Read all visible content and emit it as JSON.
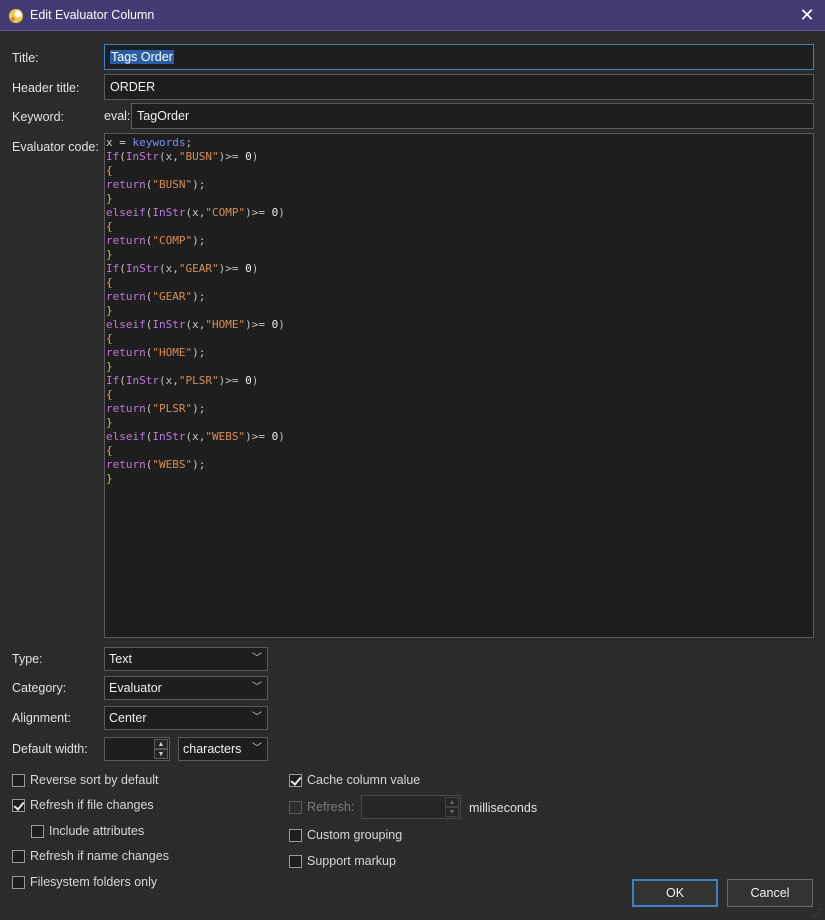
{
  "window": {
    "title": "Edit Evaluator Column",
    "close_icon": "close-icon",
    "app_icon": "app-icon"
  },
  "form": {
    "title_label": "Title:",
    "title_value": "Tags Order",
    "header_title_label": "Header title:",
    "header_title_value": "ORDER",
    "keyword_label": "Keyword:",
    "keyword_prefix": "eval:",
    "keyword_value": "TagOrder",
    "evaluator_code_label": "Evaluator code:"
  },
  "code_lines": [
    [
      [
        "plain",
        "x = "
      ],
      [
        "kw-blue",
        "keywords"
      ],
      [
        "punct",
        ";"
      ]
    ],
    [
      [
        "kw-purple",
        "If"
      ],
      [
        "punct",
        "("
      ],
      [
        "kw-purple",
        "InStr"
      ],
      [
        "punct",
        "(x,"
      ],
      [
        "str",
        "\"BUSN\""
      ],
      [
        "punct",
        ")>= "
      ],
      [
        "num",
        "0"
      ],
      [
        "punct",
        ")"
      ]
    ],
    [
      [
        "brace",
        "{"
      ]
    ],
    [
      [
        "kw-purple",
        "return"
      ],
      [
        "punct",
        "("
      ],
      [
        "str",
        "\"BUSN\""
      ],
      [
        "punct",
        ");"
      ]
    ],
    [
      [
        "brace",
        "}"
      ]
    ],
    [
      [
        "kw-purple",
        "elseif"
      ],
      [
        "punct",
        "("
      ],
      [
        "kw-purple",
        "InStr"
      ],
      [
        "punct",
        "(x,"
      ],
      [
        "str",
        "\"COMP\""
      ],
      [
        "punct",
        ")>= "
      ],
      [
        "num",
        "0"
      ],
      [
        "punct",
        ")"
      ]
    ],
    [
      [
        "brace",
        "{"
      ]
    ],
    [
      [
        "kw-purple",
        "return"
      ],
      [
        "punct",
        "("
      ],
      [
        "str",
        "\"COMP\""
      ],
      [
        "punct",
        ");"
      ]
    ],
    [
      [
        "brace",
        "}"
      ]
    ],
    [
      [
        "kw-purple",
        "If"
      ],
      [
        "punct",
        "("
      ],
      [
        "kw-purple",
        "InStr"
      ],
      [
        "punct",
        "(x,"
      ],
      [
        "str",
        "\"GEAR\""
      ],
      [
        "punct",
        ")>= "
      ],
      [
        "num",
        "0"
      ],
      [
        "punct",
        ")"
      ]
    ],
    [
      [
        "brace",
        "{"
      ]
    ],
    [
      [
        "kw-purple",
        "return"
      ],
      [
        "punct",
        "("
      ],
      [
        "str",
        "\"GEAR\""
      ],
      [
        "punct",
        ");"
      ]
    ],
    [
      [
        "brace",
        "}"
      ]
    ],
    [
      [
        "kw-purple",
        "elseif"
      ],
      [
        "punct",
        "("
      ],
      [
        "kw-purple",
        "InStr"
      ],
      [
        "punct",
        "(x,"
      ],
      [
        "str",
        "\"HOME\""
      ],
      [
        "punct",
        ")>= "
      ],
      [
        "num",
        "0"
      ],
      [
        "punct",
        ")"
      ]
    ],
    [
      [
        "brace",
        "{"
      ]
    ],
    [
      [
        "kw-purple",
        "return"
      ],
      [
        "punct",
        "("
      ],
      [
        "str",
        "\"HOME\""
      ],
      [
        "punct",
        ");"
      ]
    ],
    [
      [
        "brace",
        "}"
      ]
    ],
    [
      [
        "kw-purple",
        "If"
      ],
      [
        "punct",
        "("
      ],
      [
        "kw-purple",
        "InStr"
      ],
      [
        "punct",
        "(x,"
      ],
      [
        "str",
        "\"PLSR\""
      ],
      [
        "punct",
        ")>= "
      ],
      [
        "num",
        "0"
      ],
      [
        "punct",
        ")"
      ]
    ],
    [
      [
        "brace",
        "{"
      ]
    ],
    [
      [
        "kw-purple",
        "return"
      ],
      [
        "punct",
        "("
      ],
      [
        "str",
        "\"PLSR\""
      ],
      [
        "punct",
        ");"
      ]
    ],
    [
      [
        "brace",
        "}"
      ]
    ],
    [
      [
        "kw-purple",
        "elseif"
      ],
      [
        "punct",
        "("
      ],
      [
        "kw-purple",
        "InStr"
      ],
      [
        "punct",
        "(x,"
      ],
      [
        "str",
        "\"WEBS\""
      ],
      [
        "punct",
        ")>= "
      ],
      [
        "num",
        "0"
      ],
      [
        "punct",
        ")"
      ]
    ],
    [
      [
        "brace",
        "{"
      ]
    ],
    [
      [
        "kw-purple",
        "return"
      ],
      [
        "punct",
        "("
      ],
      [
        "str",
        "\"WEBS\""
      ],
      [
        "punct",
        ");"
      ]
    ],
    [
      [
        "brace",
        "}"
      ]
    ]
  ],
  "options": {
    "type_label": "Type:",
    "type_value": "Text",
    "category_label": "Category:",
    "category_value": "Evaluator",
    "alignment_label": "Alignment:",
    "alignment_value": "Center",
    "default_width_label": "Default width:",
    "default_width_value": "",
    "width_unit_value": "characters"
  },
  "checkboxes": {
    "reverse_sort": {
      "label": "Reverse sort by default",
      "checked": false
    },
    "refresh_file": {
      "label": "Refresh if file changes",
      "checked": true
    },
    "include_attributes": {
      "label": "Include attributes",
      "checked": false
    },
    "refresh_name": {
      "label": "Refresh if name changes",
      "checked": false
    },
    "filesystem_only": {
      "label": "Filesystem folders only",
      "checked": false
    },
    "cache_value": {
      "label": "Cache column value",
      "checked": true
    },
    "refresh_interval": {
      "label": "Refresh:",
      "checked": false,
      "disabled": true
    },
    "custom_grouping": {
      "label": "Custom grouping",
      "checked": false
    },
    "support_markup": {
      "label": "Support markup",
      "checked": false
    }
  },
  "refresh_interval": {
    "value": "",
    "unit": "milliseconds"
  },
  "buttons": {
    "ok": "OK",
    "cancel": "Cancel"
  },
  "colors": {
    "titlebar": "#433b74",
    "background": "#2b2b2b",
    "focus_accent": "#3a82c4"
  }
}
